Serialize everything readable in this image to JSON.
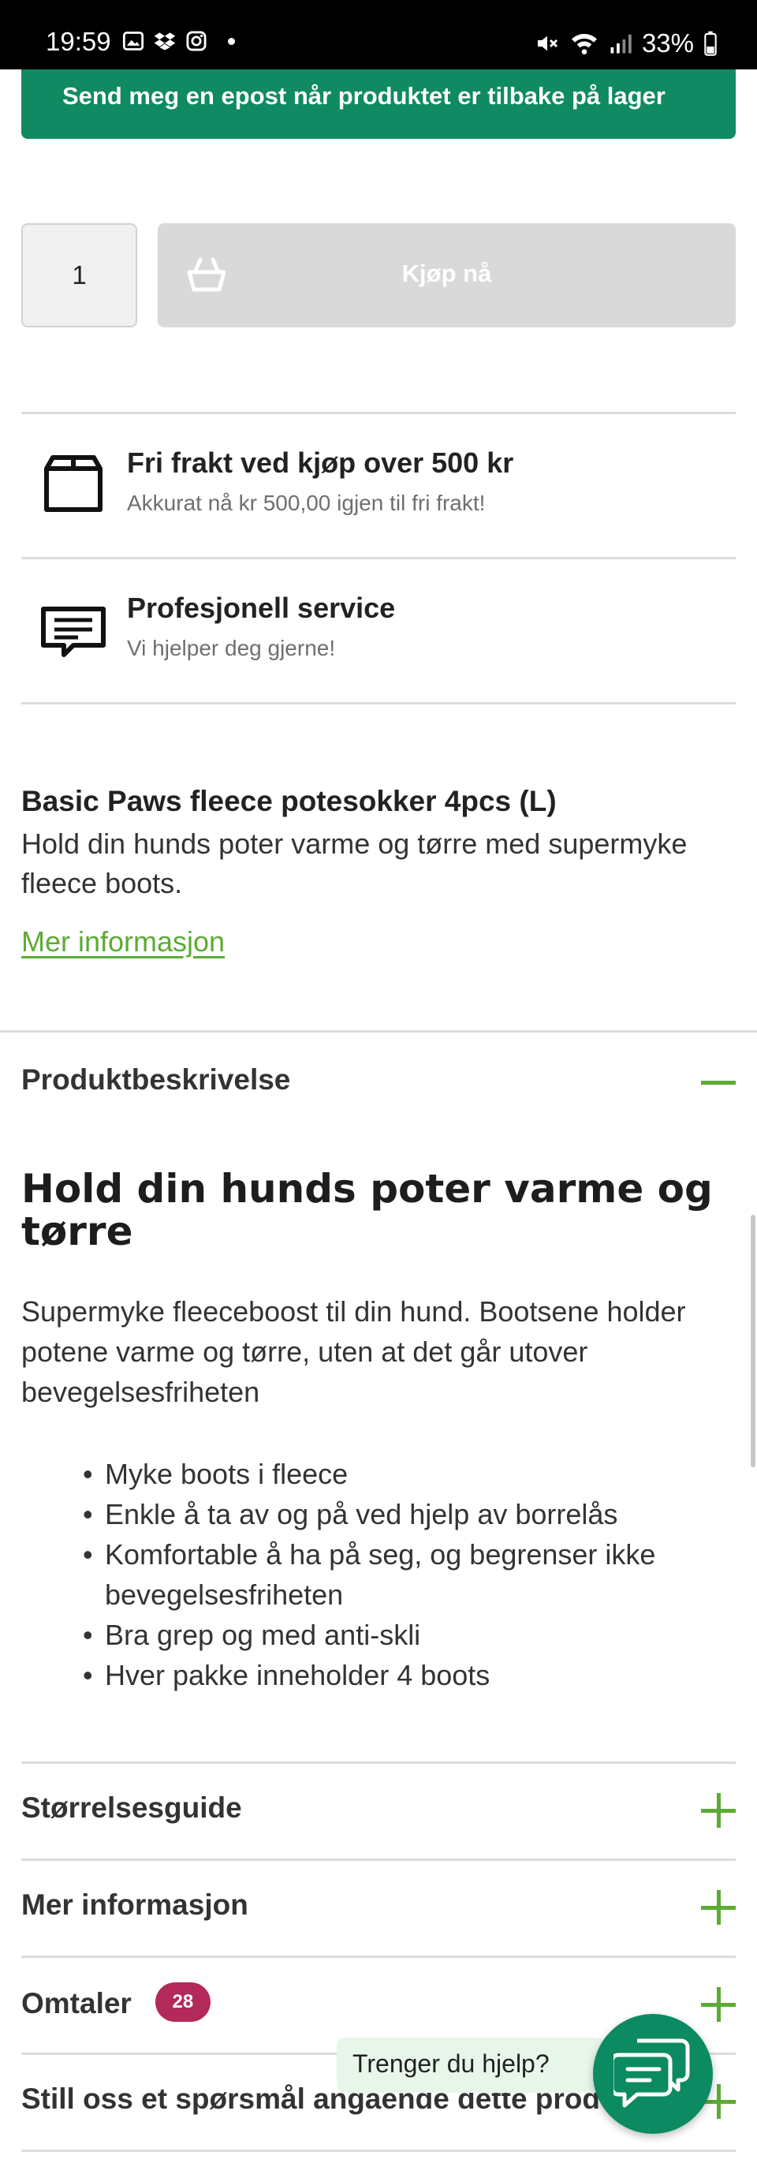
{
  "status_bar": {
    "time": "19:59",
    "battery": "33%"
  },
  "notify_button": {
    "label": "Send meg en epost når produktet er tilbake på lager"
  },
  "purchase": {
    "quantity": "1",
    "buy_label": "Kjøp nå"
  },
  "info_rows": [
    {
      "title": "Fri frakt ved kjøp over 500 kr",
      "subtitle": "Akkurat nå kr 500,00 igjen til fri frakt!",
      "icon": "box-icon"
    },
    {
      "title": "Profesjonell service",
      "subtitle": "Vi hjelper deg gjerne!",
      "icon": "message-icon"
    }
  ],
  "product": {
    "name": "Basic Paws fleece potesokker 4pcs (L)",
    "short_description": "Hold din hunds poter varme og tørre med supermyke fleece boots.",
    "more_link": "Mer informasjon"
  },
  "description_section": {
    "title": "Produktbeskrivelse",
    "heading": "Hold din hunds poter varme og tørre",
    "paragraph": "Supermyke fleeceboost til din hund. Bootsene holder potene varme og tørre, uten at det går utover bevegelsesfriheten",
    "bullets": [
      "Myke boots i fleece",
      "Enkle å ta av og på ved hjelp av borrelås",
      "Komfortable å ha på seg, og begrenser ikke bevegelsesfriheten",
      "Bra grep og med anti-skli",
      "Hver pakke inneholder 4 boots"
    ]
  },
  "accordions": [
    {
      "title": "Størrelsesguide"
    },
    {
      "title": "Mer informasjon"
    },
    {
      "title": "Omtaler",
      "badge": "28"
    },
    {
      "title": "Still oss et spørsmål angående dette produktet"
    }
  ],
  "help": {
    "bubble_text": "Trenger du hjelp?"
  },
  "colors": {
    "primary_green": "#0f8a62",
    "accent_green": "#5cab33",
    "badge": "#b2295a"
  }
}
